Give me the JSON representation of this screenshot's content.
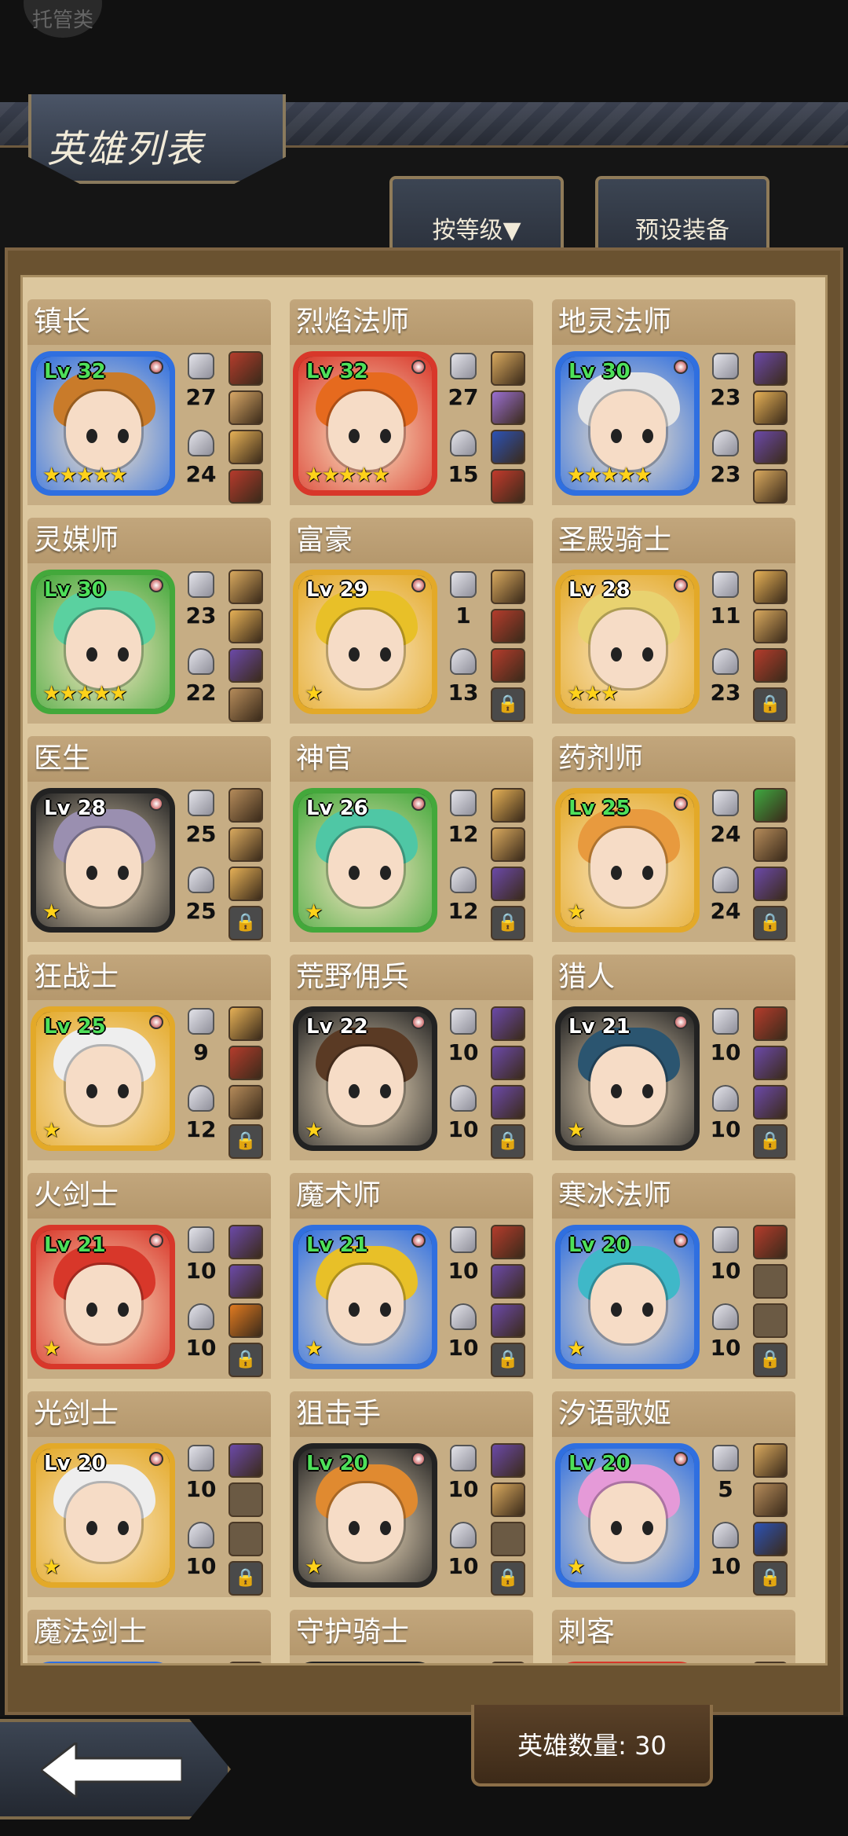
{
  "top": {
    "manage_label": "托管类"
  },
  "header": {
    "title": "英雄列表",
    "sort_tab": "按等级▼",
    "preset_tab": "预设装备"
  },
  "footer": {
    "hero_count": "英雄数量: 30"
  },
  "heroes": [
    {
      "name": "镇长",
      "level": "Lv 32",
      "atk": "27",
      "def": "24",
      "stars": "★★★★★",
      "frame": "#2f6fe0",
      "hair": "#c97b2a",
      "slots": [
        "#b43c2c",
        "#d8a766",
        "#e5b056",
        "#b53a2c"
      ]
    },
    {
      "name": "烈焰法师",
      "level": "Lv 32",
      "atk": "27",
      "def": "15",
      "stars": "★★★★★",
      "frame": "#d8372a",
      "hair": "#e66a1e",
      "slots": [
        "#d9a95e",
        "#9a6fd1",
        "#2c52b5",
        "#c23a2c"
      ]
    },
    {
      "name": "地灵法师",
      "level": "Lv 30",
      "atk": "23",
      "def": "23",
      "stars": "★★★★★",
      "frame": "#2f6fe0",
      "hair": "#e5e5e5",
      "slots": [
        "#6b49a8",
        "#e5b056",
        "#6b49a8",
        "#d9a95e"
      ]
    },
    {
      "name": "灵媒师",
      "level": "Lv 30",
      "atk": "23",
      "def": "22",
      "stars": "★★★★★",
      "frame": "#43a83b",
      "hair": "#5ad1a0",
      "slots": [
        "#d9a95e",
        "#e5b056",
        "#6b49a8",
        "#b58b5a"
      ]
    },
    {
      "name": "富豪",
      "level": "Lv 29",
      "atk": "1",
      "def": "13",
      "stars": "★",
      "frame": "#e3a928",
      "hair": "#e8c028",
      "slots": [
        "#d9a95e",
        "#b43c2c",
        "#b43c2c",
        "lock"
      ]
    },
    {
      "name": "圣殿骑士",
      "level": "Lv 28",
      "atk": "11",
      "def": "23",
      "stars": "★★★",
      "frame": "#e3a928",
      "hair": "#e8d270",
      "slots": [
        "#e5b056",
        "#d9a95e",
        "#b43c2c",
        "lock"
      ]
    },
    {
      "name": "医生",
      "level": "Lv 28",
      "atk": "25",
      "def": "25",
      "stars": "★",
      "frame": "#222222",
      "hair": "#9a8fb0",
      "slots": [
        "#b58b5a",
        "#d9a95e",
        "#e5b056",
        "lock"
      ]
    },
    {
      "name": "神官",
      "level": "Lv 26",
      "atk": "12",
      "def": "12",
      "stars": "★",
      "frame": "#43a83b",
      "hair": "#4fc7a5",
      "slots": [
        "#e5b056",
        "#d9a95e",
        "#6b49a8",
        "lock"
      ]
    },
    {
      "name": "药剂师",
      "level": "Lv 25",
      "atk": "24",
      "def": "24",
      "stars": "★",
      "frame": "#e3a928",
      "hair": "#e89a3e",
      "slots": [
        "#3fa840",
        "#b58b5a",
        "#6b49a8",
        "lock"
      ]
    },
    {
      "name": "狂战士",
      "level": "Lv 25",
      "atk": "9",
      "def": "12",
      "stars": "★",
      "frame": "#e3a928",
      "hair": "#eeeeee",
      "slots": [
        "#e5b056",
        "#b43c2c",
        "#b58b5a",
        "lock"
      ]
    },
    {
      "name": "荒野佣兵",
      "level": "Lv 22",
      "atk": "10",
      "def": "10",
      "stars": "★",
      "frame": "#222222",
      "hair": "#5a3a24",
      "slots": [
        "#6b49a8",
        "#6b49a8",
        "#6b49a8",
        "lock"
      ]
    },
    {
      "name": "猎人",
      "level": "Lv 21",
      "atk": "10",
      "def": "10",
      "stars": "★",
      "frame": "#222222",
      "hair": "#2b5570",
      "slots": [
        "#b43c2c",
        "#6b49a8",
        "#6b49a8",
        "lock"
      ]
    },
    {
      "name": "火剑士",
      "level": "Lv 21",
      "atk": "10",
      "def": "10",
      "stars": "★",
      "frame": "#d8372a",
      "hair": "#d8372a",
      "slots": [
        "#6b49a8",
        "#6b49a8",
        "#e07a20",
        "lock"
      ]
    },
    {
      "name": "魔术师",
      "level": "Lv 21",
      "atk": "10",
      "def": "10",
      "stars": "★",
      "frame": "#2f6fe0",
      "hair": "#e8c028",
      "slots": [
        "#b43c2c",
        "#6b49a8",
        "#6b49a8",
        "lock"
      ]
    },
    {
      "name": "寒冰法师",
      "level": "Lv 20",
      "atk": "10",
      "def": "10",
      "stars": "★",
      "frame": "#2f6fe0",
      "hair": "#3fb8c8",
      "slots": [
        "#b43c2c",
        "empty",
        "empty",
        "lock"
      ]
    },
    {
      "name": "光剑士",
      "level": "Lv 20",
      "atk": "10",
      "def": "10",
      "stars": "★",
      "frame": "#e3a928",
      "hair": "#eeeeee",
      "slots": [
        "#6b49a8",
        "empty",
        "empty",
        "lock"
      ]
    },
    {
      "name": "狙击手",
      "level": "Lv 20",
      "atk": "10",
      "def": "10",
      "stars": "★",
      "frame": "#222222",
      "hair": "#e08a30",
      "slots": [
        "#6b49a8",
        "#d9a95e",
        "empty",
        "lock"
      ]
    },
    {
      "name": "汐语歌姬",
      "level": "Lv 20",
      "atk": "5",
      "def": "10",
      "stars": "★",
      "frame": "#2f6fe0",
      "hair": "#e59ad8",
      "slots": [
        "#d9a95e",
        "#b58b5a",
        "#2c52b5",
        "lock"
      ]
    },
    {
      "name": "魔法剑士",
      "level": "",
      "atk": "",
      "def": "",
      "stars": "",
      "frame": "#2f6fe0",
      "hair": "#444444",
      "slots": [
        "#2c52b5"
      ]
    },
    {
      "name": "守护骑士",
      "level": "",
      "atk": "",
      "def": "",
      "stars": "",
      "frame": "#222222",
      "hair": "#444444",
      "slots": [
        "#b43c2c"
      ]
    },
    {
      "name": "刺客",
      "level": "",
      "atk": "",
      "def": "",
      "stars": "",
      "frame": "#d8372a",
      "hair": "#444444",
      "slots": [
        "#6b49a8"
      ]
    }
  ]
}
